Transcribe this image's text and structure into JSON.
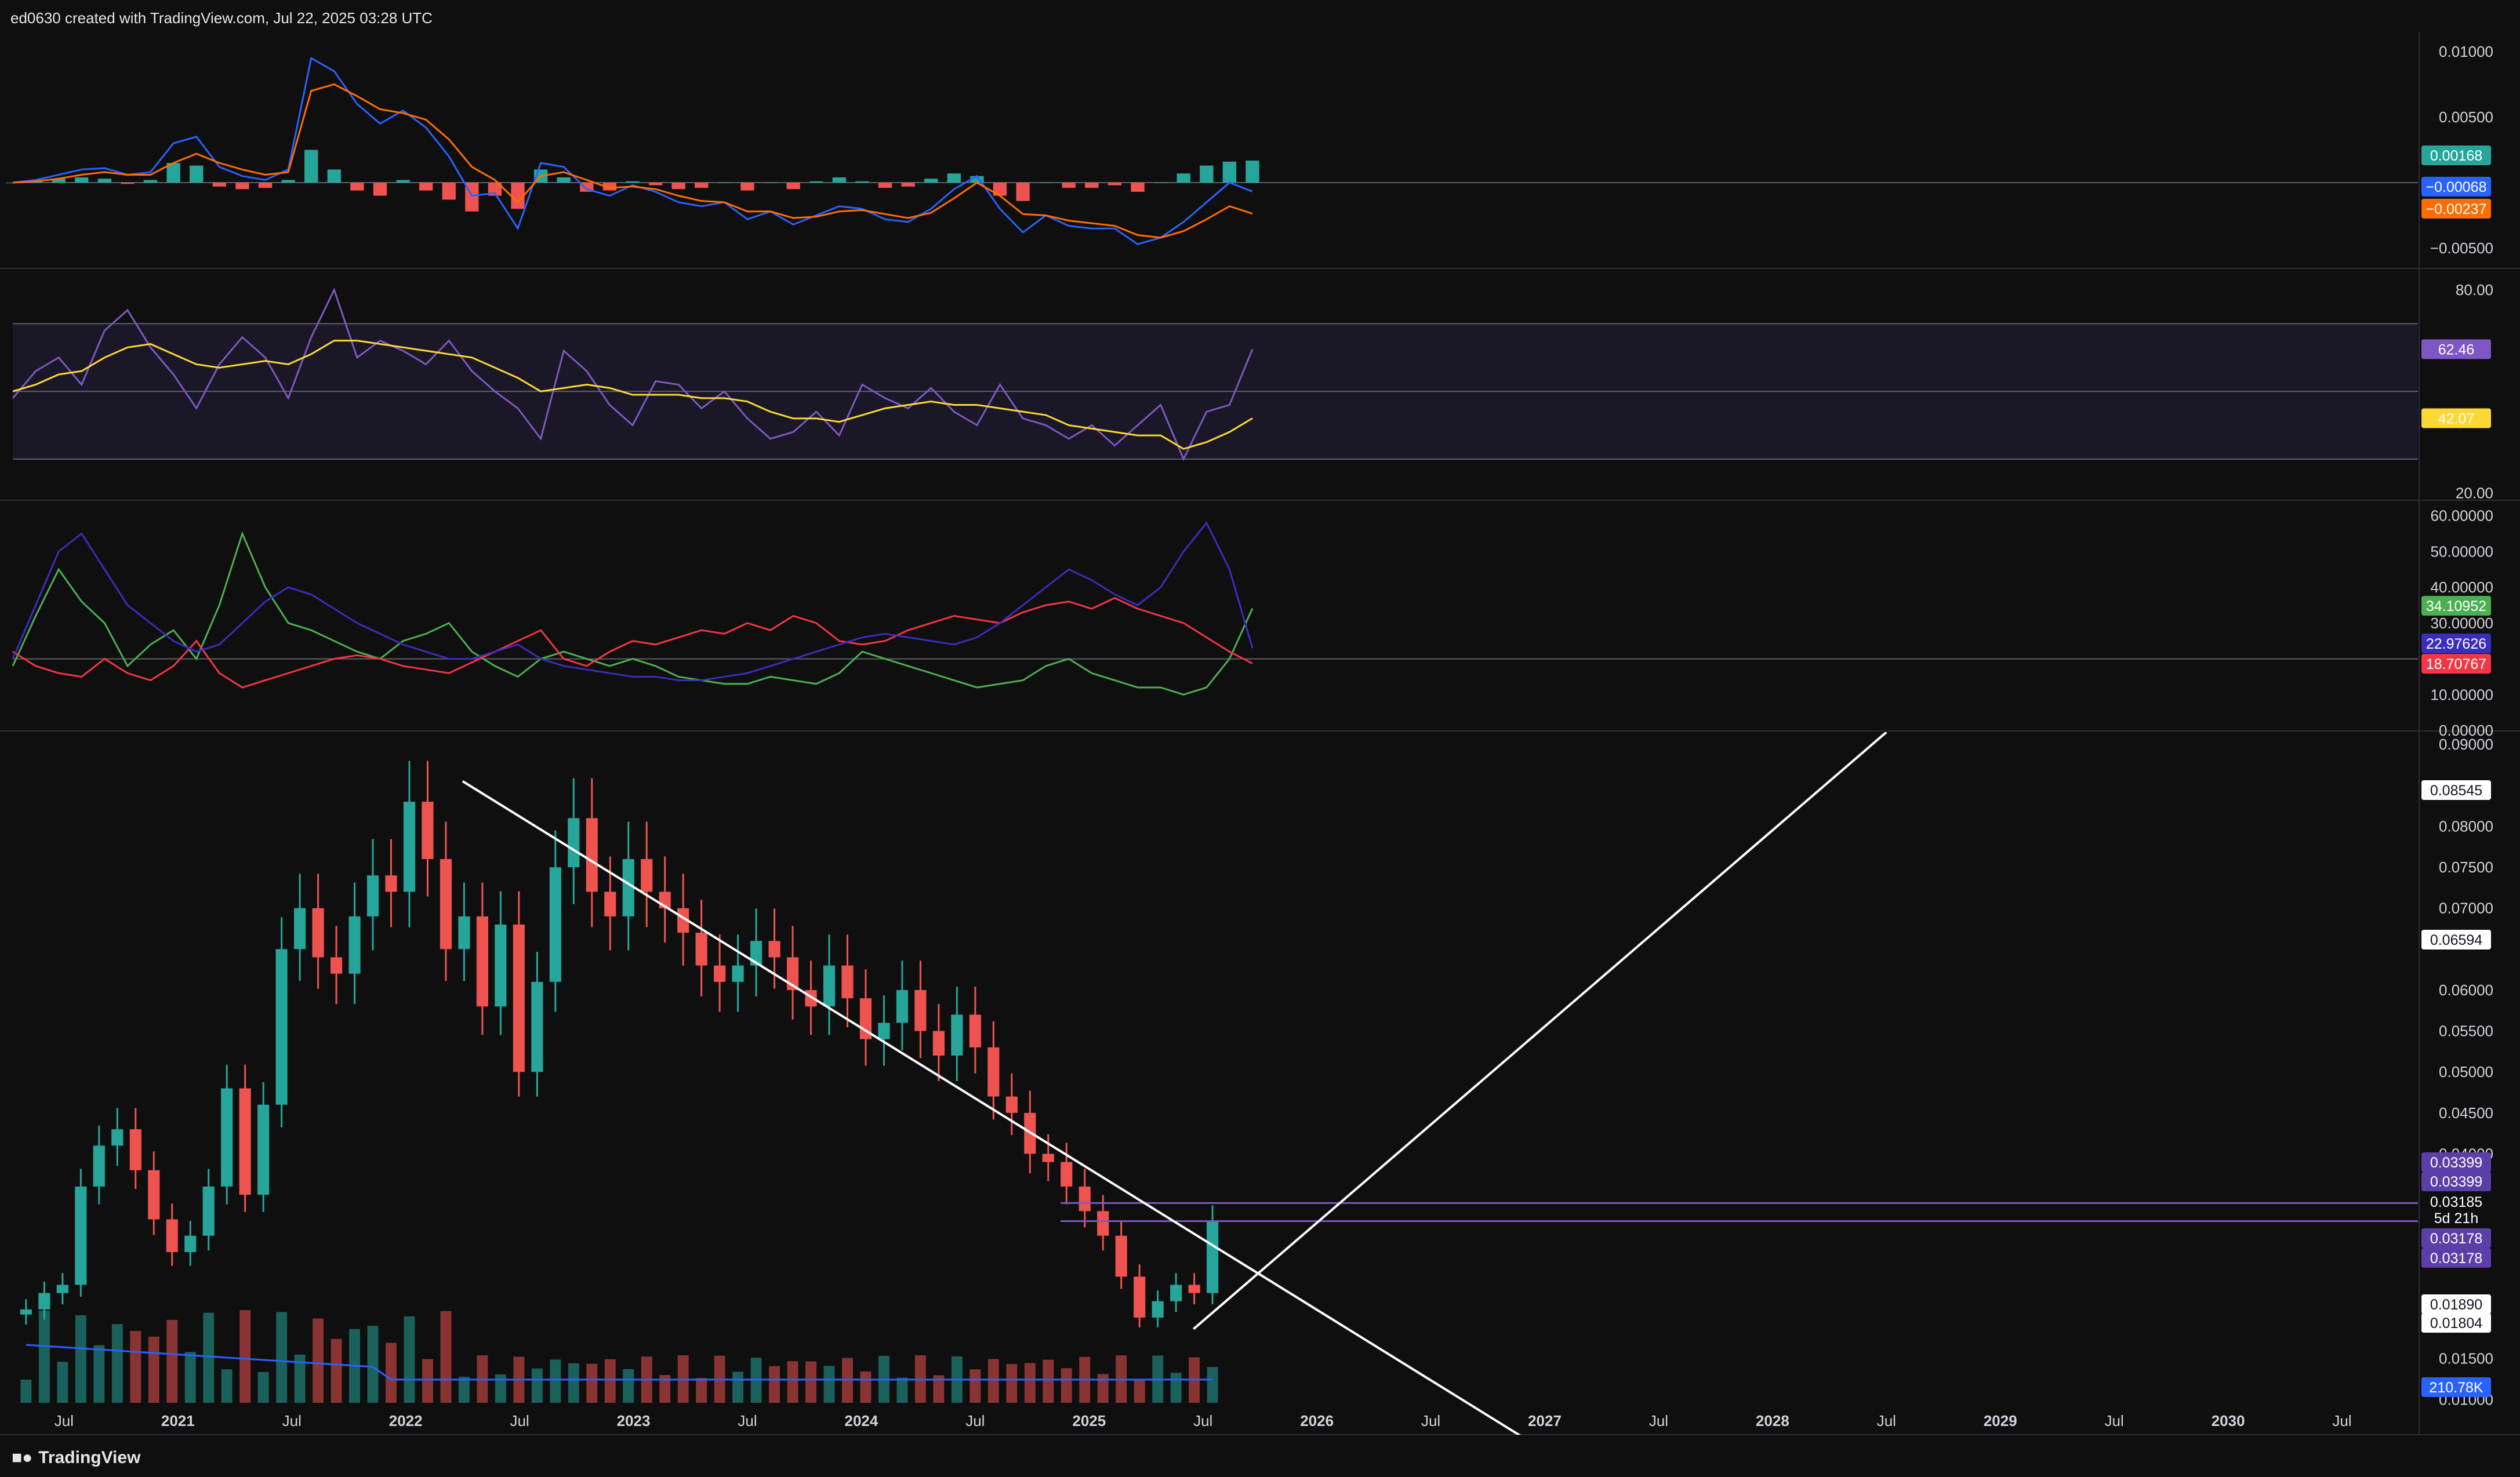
{
  "header": {
    "credit": "ed0630 created with TradingView.com, Jul 22, 2025 03:28 UTC"
  },
  "footer": {
    "brand": "TradingView",
    "brand_icon": "tradingview-logo-icon"
  },
  "colors": {
    "background": "#0f0f0f",
    "up": "#26a69a",
    "down": "#ef5350",
    "macd_line": "#2962ff",
    "signal_line": "#ff6d00",
    "rsi": "#7e57c2",
    "rsi_ma": "#fdd835",
    "dmi_plus": "#4caf50",
    "dmi_minus": "#f23645",
    "adx": "#3b2dbd",
    "volume_ma": "#2962ff",
    "trendline": "#ffffff",
    "level_line": "#7e57c2"
  },
  "chart_data": [
    {
      "type": "line",
      "panel": "MACD",
      "yticks": [
        "0.01000",
        "0.00500",
        "−0.00500"
      ],
      "ylim": [
        -0.0065,
        0.0115
      ],
      "value_labels": [
        {
          "text": "0.00168",
          "value": 0.00168,
          "color": "#26a69a"
        },
        {
          "text": "−0.00068",
          "value": -0.00068,
          "color": "#2962ff"
        },
        {
          "text": "−0.00237",
          "value": -0.00237,
          "color": "#ff6d00"
        }
      ],
      "series": [
        {
          "name": "",
          "values": [
            0.0,
            0.0002,
            0.0006,
            0.001,
            0.0011,
            0.0006,
            0.0008,
            0.003,
            0.0035,
            0.0012,
            0.0005,
            0.0002,
            0.001,
            0.0095,
            0.0085,
            0.006,
            0.0045,
            0.0055,
            0.0042,
            0.002,
            -0.001,
            -0.0008,
            -0.0035,
            0.0015,
            0.0012,
            -0.0005,
            -0.001,
            -0.0002,
            -0.0007,
            -0.0015,
            -0.0018,
            -0.0015,
            -0.0028,
            -0.0022,
            -0.0032,
            -0.0025,
            -0.0018,
            -0.002,
            -0.0028,
            -0.003,
            -0.002,
            -0.0005,
            0.0005,
            -0.002,
            -0.0038,
            -0.0025,
            -0.0033,
            -0.0035,
            -0.0035,
            -0.0047,
            -0.0042,
            -0.003,
            -0.0015,
            0.0,
            -0.00068
          ]
        },
        {
          "name": "",
          "values": [
            0.0,
            0.0001,
            0.0003,
            0.0006,
            0.0008,
            0.0006,
            0.0006,
            0.0015,
            0.0022,
            0.0015,
            0.001,
            0.0006,
            0.0008,
            0.007,
            0.0075,
            0.0066,
            0.0056,
            0.0053,
            0.0048,
            0.0033,
            0.0012,
            0.0002,
            -0.0015,
            0.0005,
            0.0008,
            0.0002,
            -0.0004,
            -0.0003,
            -0.0005,
            -0.001,
            -0.0014,
            -0.0015,
            -0.0022,
            -0.0022,
            -0.0027,
            -0.0026,
            -0.0022,
            -0.0021,
            -0.0024,
            -0.0027,
            -0.0023,
            -0.0012,
            0.0,
            -0.001,
            -0.0024,
            -0.0025,
            -0.0029,
            -0.0031,
            -0.0033,
            -0.004,
            -0.0042,
            -0.0037,
            -0.0028,
            -0.0018,
            -0.00237
          ]
        }
      ],
      "histogram": [
        0.0,
        0.0001,
        0.0003,
        0.0004,
        0.0003,
        -0.0001,
        0.0002,
        0.0015,
        0.0013,
        -0.0003,
        -0.0005,
        -0.0004,
        0.0002,
        0.0025,
        0.001,
        -0.0006,
        -0.001,
        0.0002,
        -0.0006,
        -0.0013,
        -0.0022,
        -0.001,
        -0.002,
        0.001,
        0.0004,
        -0.0007,
        -0.0006,
        0.0001,
        -0.0002,
        -0.0005,
        -0.0004,
        0.0,
        -0.0006,
        0.0,
        -0.0005,
        0.0001,
        0.0004,
        0.0001,
        -0.0004,
        -0.0003,
        0.0003,
        0.0007,
        0.0005,
        -0.001,
        -0.0014,
        0.0,
        -0.0004,
        -0.0004,
        -0.0002,
        -0.0007,
        0.0,
        0.0007,
        0.0013,
        0.0016,
        0.00168
      ]
    },
    {
      "type": "line",
      "panel": "RSI",
      "yticks": [
        "80.00",
        "20.00"
      ],
      "ylim": [
        18,
        86
      ],
      "bands": [
        30,
        50,
        70
      ],
      "value_labels": [
        {
          "text": "62.46",
          "value": 62.46,
          "color": "#7e57c2"
        },
        {
          "text": "42.07",
          "value": 42.07,
          "color": "#fdd835"
        }
      ],
      "series": [
        {
          "name": "",
          "values": [
            48,
            56,
            60,
            52,
            68,
            74,
            63,
            55,
            45,
            58,
            66,
            60,
            48,
            66,
            80,
            60,
            65,
            62,
            58,
            65,
            56,
            50,
            45,
            36,
            62,
            56,
            46,
            40,
            53,
            52,
            45,
            50,
            42,
            36,
            38,
            44,
            37,
            52,
            48,
            45,
            51,
            44,
            40,
            52,
            42,
            40,
            36,
            40,
            34,
            40,
            46,
            30,
            44,
            46,
            62.46
          ]
        },
        {
          "name": "",
          "values": [
            50,
            52,
            55,
            56,
            60,
            63,
            64,
            61,
            58,
            57,
            58,
            59,
            58,
            61,
            65,
            65,
            64,
            63,
            62,
            61,
            60,
            57,
            54,
            50,
            51,
            52,
            51,
            49,
            49,
            49,
            48,
            48,
            47,
            44,
            42,
            42,
            41,
            43,
            45,
            46,
            47,
            46,
            46,
            45,
            44,
            43,
            40,
            39,
            38,
            37,
            37,
            33,
            35,
            38,
            42.07
          ]
        }
      ]
    },
    {
      "type": "line",
      "panel": "DMI",
      "yticks": [
        "60.00000",
        "50.00000",
        "40.00000",
        "30.00000",
        "10.00000",
        "0.00000"
      ],
      "ylim": [
        0,
        64
      ],
      "reference_level": 20,
      "value_labels": [
        {
          "text": "34.10952",
          "value": 34.10952,
          "color": "#4caf50"
        },
        {
          "text": "22.97626",
          "value": 22.97626,
          "color": "#3b2dbd"
        },
        {
          "text": "18.70767",
          "value": 18.70767,
          "color": "#f23645"
        }
      ],
      "series": [
        {
          "name": "",
          "values": [
            18,
            32,
            45,
            36,
            30,
            18,
            24,
            28,
            20,
            35,
            55,
            40,
            30,
            28,
            25,
            22,
            20,
            25,
            27,
            30,
            22,
            18,
            15,
            20,
            22,
            20,
            18,
            20,
            18,
            15,
            14,
            13,
            13,
            15,
            14,
            13,
            16,
            22,
            20,
            18,
            16,
            14,
            12,
            13,
            14,
            18,
            20,
            16,
            14,
            12,
            12,
            10,
            12,
            20,
            34.10952
          ]
        },
        {
          "name": "",
          "values": [
            22,
            18,
            16,
            15,
            20,
            16,
            14,
            18,
            25,
            16,
            12,
            14,
            16,
            18,
            20,
            21,
            20,
            18,
            17,
            16,
            19,
            22,
            25,
            28,
            20,
            18,
            22,
            25,
            24,
            26,
            28,
            27,
            30,
            28,
            32,
            30,
            25,
            24,
            25,
            28,
            30,
            32,
            31,
            30,
            33,
            35,
            36,
            34,
            37,
            34,
            32,
            30,
            26,
            22,
            18.70767
          ]
        },
        {
          "name": "",
          "values": [
            20,
            35,
            50,
            55,
            45,
            35,
            30,
            25,
            22,
            24,
            30,
            36,
            40,
            38,
            34,
            30,
            27,
            24,
            22,
            20,
            20,
            22,
            24,
            20,
            18,
            17,
            16,
            15,
            15,
            14,
            14,
            15,
            16,
            18,
            20,
            22,
            24,
            26,
            27,
            26,
            25,
            24,
            26,
            30,
            35,
            40,
            45,
            42,
            38,
            35,
            40,
            50,
            58,
            45,
            22.97626
          ]
        }
      ]
    },
    {
      "type": "candlestick",
      "panel": "Price",
      "xticks": [
        "Jul",
        "2021",
        "Jul",
        "2022",
        "Jul",
        "2023",
        "Jul",
        "2024",
        "Jul",
        "2025",
        "Jul",
        "2026",
        "Jul",
        "2027",
        "Jul",
        "2028",
        "Jul",
        "2029",
        "Jul",
        "2030",
        "Jul"
      ],
      "xtick_months_from_2021": [
        -6,
        0,
        6,
        12,
        18,
        24,
        30,
        36,
        42,
        48,
        54,
        60,
        66,
        72,
        78,
        84,
        90,
        96,
        102,
        108,
        114
      ],
      "xlim_months_from_2021": [
        -8.7,
        118
      ],
      "yticks": [
        "0.09000",
        "0.08000",
        "0.07500",
        "0.07000",
        "0.06000",
        "0.05500",
        "0.05000",
        "0.04500",
        "0.04000",
        "0.01500",
        "0.01000"
      ],
      "ylim": [
        0.0057,
        0.0915
      ],
      "closes": [
        0.021,
        0.023,
        0.024,
        0.036,
        0.041,
        0.043,
        0.038,
        0.032,
        0.028,
        0.03,
        0.036,
        0.048,
        0.035,
        0.046,
        0.065,
        0.07,
        0.064,
        0.062,
        0.069,
        0.074,
        0.072,
        0.083,
        0.076,
        0.065,
        0.069,
        0.058,
        0.068,
        0.05,
        0.061,
        0.075,
        0.081,
        0.072,
        0.069,
        0.076,
        0.072,
        0.07,
        0.067,
        0.063,
        0.061,
        0.063,
        0.066,
        0.064,
        0.06,
        0.058,
        0.063,
        0.059,
        0.054,
        0.056,
        0.06,
        0.055,
        0.052,
        0.057,
        0.053,
        0.047,
        0.045,
        0.04,
        0.039,
        0.036,
        0.033,
        0.03,
        0.025,
        0.02,
        0.022,
        0.024,
        0.023,
        0.0318
      ],
      "volume_label": {
        "text": "210.78K",
        "color": "#2962ff"
      },
      "value_labels": [
        {
          "text": "0.08545",
          "value": 0.08545,
          "color": "#ffffff"
        },
        {
          "text": "0.06594",
          "value": 0.06594,
          "color": "#ffffff"
        },
        {
          "text": "0.03399",
          "value": 0.03399,
          "color": "#5b3fa8"
        },
        {
          "text": "0.03399",
          "value": 0.03399,
          "color": "#5b3fa8"
        },
        {
          "text": "0.03185",
          "value": 0.03185,
          "color": "#0f0f0f"
        },
        {
          "text": "5d 21h",
          "value": 0.0305,
          "color": "#0f0f0f"
        },
        {
          "text": "0.03178",
          "value": 0.03178,
          "color": "#5b3fa8"
        },
        {
          "text": "0.03178",
          "value": 0.03178,
          "color": "#5b3fa8"
        },
        {
          "text": "0.01890",
          "value": 0.0189,
          "color": "#ffffff"
        },
        {
          "text": "0.01804",
          "value": 0.01804,
          "color": "#ffffff"
        }
      ],
      "horizontal_levels": [
        0.03399,
        0.03178
      ],
      "trendlines": [
        {
          "from": [
            15,
            0.0855
          ],
          "to": [
            76,
            -0.002
          ]
        },
        {
          "from": [
            53.5,
            0.0186
          ],
          "to": [
            90,
            0.0915
          ]
        }
      ]
    }
  ]
}
